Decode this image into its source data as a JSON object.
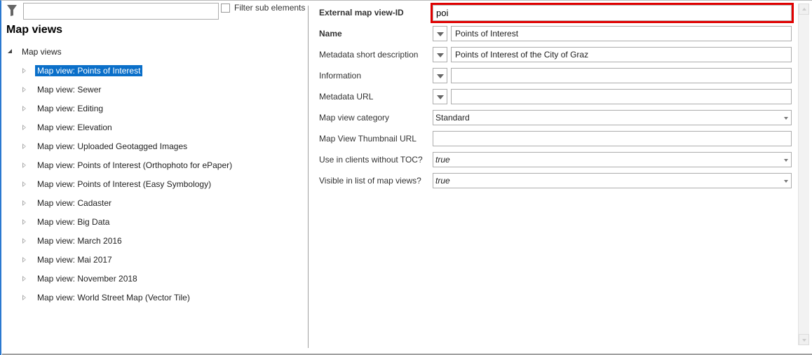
{
  "filter": {
    "value": "",
    "checkbox_label": "Filter sub elements",
    "checked": false
  },
  "tree": {
    "title": "Map views",
    "root": "Map views",
    "items": [
      "Map view: Points of Interest",
      "Map view: Sewer",
      "Map view: Editing",
      "Map view: Elevation",
      "Map view: Uploaded Geotagged Images",
      "Map view: Points of Interest (Orthophoto for ePaper)",
      "Map view: Points of Interest (Easy Symbology)",
      "Map view: Cadaster",
      "Map view: Big Data",
      "Map view: March 2016",
      "Map view: Mai 2017",
      "Map view: November 2018",
      "Map view: World Street Map (Vector Tile)"
    ],
    "selected_index": 0
  },
  "props": {
    "external_id": {
      "label": "External map view-ID",
      "value": "poi"
    },
    "name": {
      "label": "Name",
      "value": "Points of Interest"
    },
    "meta_short": {
      "label": "Metadata short description",
      "value": "Points of Interest of the City of Graz"
    },
    "information": {
      "label": "Information",
      "value": ""
    },
    "meta_url": {
      "label": "Metadata URL",
      "value": ""
    },
    "category": {
      "label": "Map view category",
      "value": "Standard"
    },
    "thumb_url": {
      "label": "Map View Thumbnail URL",
      "value": ""
    },
    "no_toc": {
      "label": "Use in clients without TOC?",
      "value": "true"
    },
    "visible": {
      "label": "Visible in list of map views?",
      "value": "true"
    }
  },
  "colors": {
    "highlight": "#e00000",
    "selection": "#0a6fc9"
  }
}
